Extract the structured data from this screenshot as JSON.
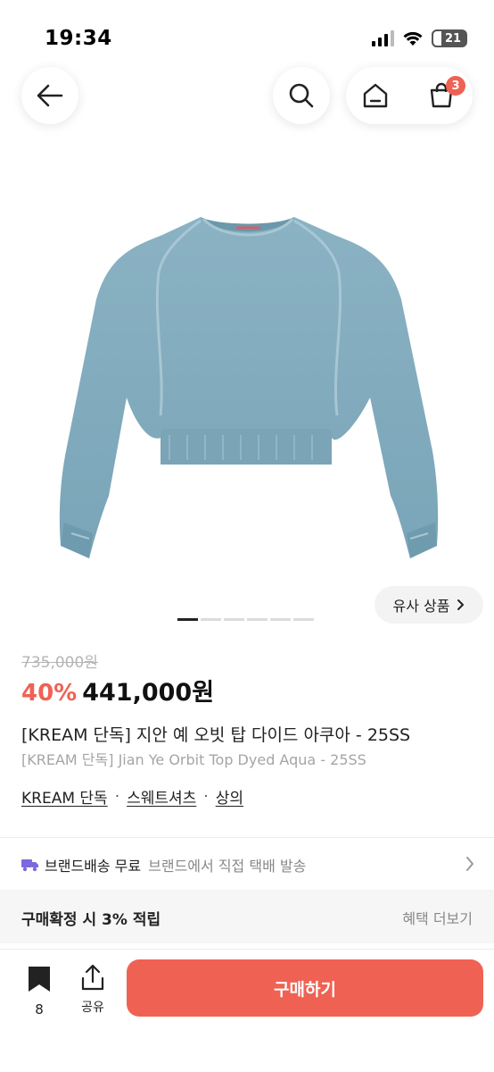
{
  "status_bar": {
    "time": "19:34",
    "battery": "21"
  },
  "nav": {
    "back_icon": "arrow-left-icon",
    "search_icon": "search-icon",
    "home_icon": "home-icon",
    "cart_icon": "shopping-bag-icon",
    "cart_badge": "3"
  },
  "product": {
    "image_alt": "aqua-sweatshirt",
    "image_color": "#7fa8ba",
    "similar_button": "유사 상품",
    "gallery_pages": 6,
    "gallery_active": 0,
    "original_price": "735,000원",
    "discount": "40%",
    "sale_price": "441,000원",
    "title_ko": "[KREAM 단독] 지안 예 오빗 탑 다이드 아쿠아 - 25SS",
    "title_en": "[KREAM 단독] Jian Ye Orbit Top Dyed Aqua - 25SS",
    "categories": [
      "KREAM 단독",
      "스웨트셔츠",
      "상의"
    ],
    "category_separator": "·"
  },
  "delivery": {
    "icon": "truck-icon",
    "label": "브랜드배송 무료",
    "desc": "브랜드에서 직접 택배 발송"
  },
  "benefit": {
    "label": "구매확정 시 3% 적립",
    "more": "혜택 더보기"
  },
  "bottom_bar": {
    "bookmark_count": "8",
    "share_label": "공유",
    "buy_label": "구매하기"
  },
  "colors": {
    "accent": "#ef6253",
    "delivery_icon": "#7a6ae0"
  }
}
